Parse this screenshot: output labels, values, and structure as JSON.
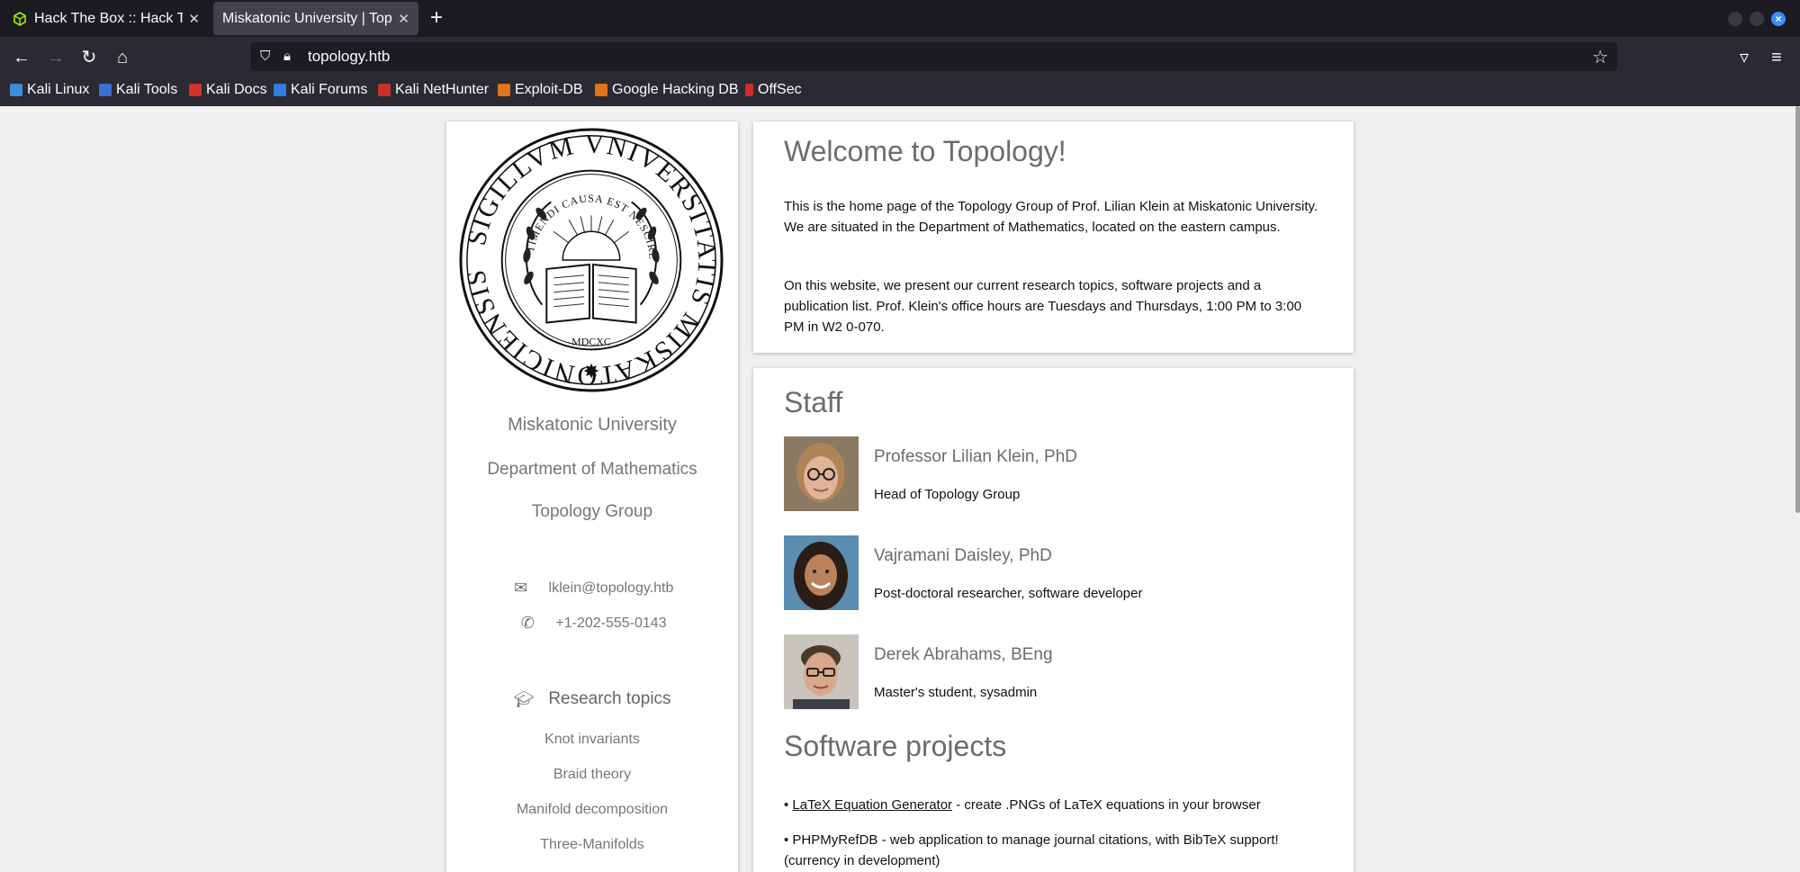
{
  "browser": {
    "tabs": [
      {
        "title": "Hack The Box :: Hack The Box"
      },
      {
        "title": "Miskatonic University | Topology Group"
      }
    ],
    "url": "topology.htb",
    "bookmarks": [
      "Kali Linux",
      "Kali Tools",
      "Kali Docs",
      "Kali Forums",
      "Kali NetHunter",
      "Exploit-DB",
      "Google Hacking DB",
      "OffSec"
    ]
  },
  "sidebar": {
    "university": "Miskatonic University",
    "department": "Department of Mathematics",
    "group": "Topology Group",
    "email": "lklein@topology.htb",
    "phone": "+1-202-555-0143",
    "research_heading": "Research topics",
    "topics": [
      "Knot invariants",
      "Braid theory",
      "Manifold decomposition",
      "Three-Manifolds"
    ]
  },
  "welcome": {
    "title": "Welcome to Topology!",
    "para1": "This is the home page of the Topology Group of Prof. Lilian Klein at Miskatonic University. We are situated in the Department of Mathematics, located on the eastern campus.",
    "para2": "On this website, we present our current research topics, software projects and a publication list. Prof. Klein's office hours are Tuesdays and Thursdays, 1:00 PM to 3:00 PM in W2 0-070."
  },
  "staff": {
    "title": "Staff",
    "members": [
      {
        "name": "Professor Lilian Klein, PhD",
        "role": "Head of Topology Group"
      },
      {
        "name": "Vajramani Daisley, PhD",
        "role": "Post-doctoral researcher, software developer"
      },
      {
        "name": "Derek Abrahams, BEng",
        "role": "Master's student, sysadmin"
      }
    ]
  },
  "projects": {
    "title": "Software projects",
    "items": [
      {
        "bullet": "• ",
        "link": "LaTeX Equation Generator",
        "desc": " - create .PNGs of LaTeX equations in your browser"
      },
      {
        "bullet": "• ",
        "text": "PHPMyRefDB - web application to manage journal citations, with BibTeX support! (currency in development)"
      }
    ]
  },
  "seal": {
    "outer_text": "SIGILLVM VNIVERSITATIS MISKATONICIENSIS",
    "inner_text": "TIMENDI CAUSA EST NESCIRE",
    "year": "MDCXC"
  }
}
